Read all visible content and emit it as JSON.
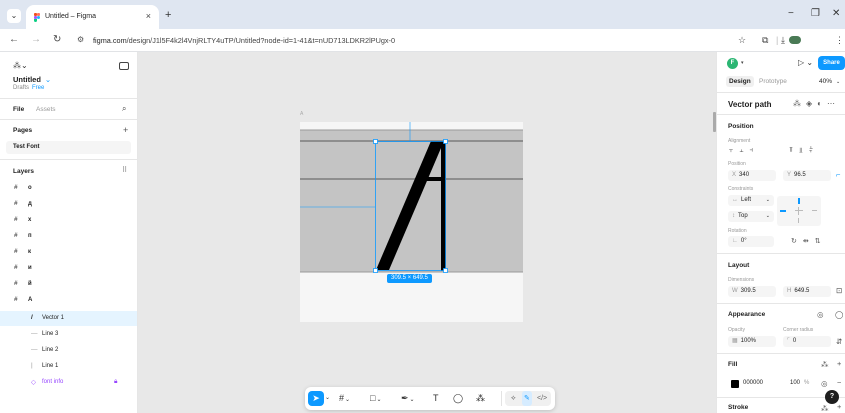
{
  "browser": {
    "tab_menu_icon": "chevron-down",
    "tab_title": "Untitled – Figma",
    "tab_close": "×",
    "new_tab": "+",
    "url_domain": "figma.com",
    "url_path": "/design/J1l5F4k2l4VnjRLTY4uTP/Untitled?node-id=1-41&t=nUD713LDKR2lPUgx-0",
    "window_minimize": "−",
    "window_maximize": "❐",
    "window_close": "✕"
  },
  "left_panel": {
    "file_title": "Untitled",
    "file_caret": "⌄",
    "drafts_label": "Drafts",
    "plan_badge": "Free",
    "tabs": [
      "File",
      "Assets"
    ],
    "pages_heading": "Pages",
    "pages": [
      "Test Font"
    ],
    "layers_heading": "Layers",
    "layers": [
      {
        "icon": "#",
        "label": "o",
        "kind": "frame"
      },
      {
        "icon": "#",
        "label": "д",
        "kind": "frame"
      },
      {
        "icon": "#",
        "label": "x",
        "kind": "frame"
      },
      {
        "icon": "#",
        "label": "п",
        "kind": "frame"
      },
      {
        "icon": "#",
        "label": "к",
        "kind": "frame"
      },
      {
        "icon": "#",
        "label": "и",
        "kind": "frame"
      },
      {
        "icon": "#",
        "label": "й",
        "kind": "frame"
      },
      {
        "icon": "#",
        "label": "A",
        "kind": "frame"
      },
      {
        "icon": "/",
        "label": "Vector 1",
        "kind": "selected"
      },
      {
        "icon": "—",
        "label": "Line 3",
        "kind": "sub"
      },
      {
        "icon": "—",
        "label": "Line 2",
        "kind": "sub"
      },
      {
        "icon": "|",
        "label": "Line 1",
        "kind": "sub"
      },
      {
        "icon": "◇",
        "label": "font info",
        "kind": "comp"
      }
    ]
  },
  "canvas": {
    "frame_label": "A",
    "dimension_badge": "309.5 × 649.5"
  },
  "toolbar": {
    "tools": [
      "move",
      "frame",
      "shape",
      "pen",
      "text",
      "comment",
      "actions"
    ],
    "text_tool_glyph": "T"
  },
  "right_panel": {
    "avatar_initial": "F",
    "share_label": "Share",
    "tabs": [
      "Design",
      "Prototype"
    ],
    "zoom": "40%",
    "selection_title": "Vector path",
    "position_title": "Position",
    "alignment_label": "Alignment",
    "position_label": "Position",
    "x_label": "X",
    "x_value": "340",
    "y_label": "Y",
    "y_value": "96.5",
    "constraints_label": "Constraints",
    "constraint_h": "Left",
    "constraint_v": "Top",
    "rotation_label": "Rotation",
    "rotation_value": "0°",
    "layout_title": "Layout",
    "dimensions_label": "Dimensions",
    "w_label": "W",
    "w_value": "309.5",
    "h_label": "H",
    "h_value": "649.5",
    "appearance_title": "Appearance",
    "opacity_label": "Opacity",
    "corner_label": "Corner radius",
    "opacity_value": "100%",
    "corner_value": "0",
    "fill_title": "Fill",
    "fill_hex": "000000",
    "fill_opacity": "100",
    "fill_opacity_unit": "%",
    "fill_color": "#000000",
    "stroke_title": "Stroke",
    "help": "?"
  },
  "colors": {
    "accent": "#0d99ff",
    "component": "#9747ff",
    "chrome_bg": "#dfe6f1",
    "canvas_bg": "#e8e8e8"
  }
}
